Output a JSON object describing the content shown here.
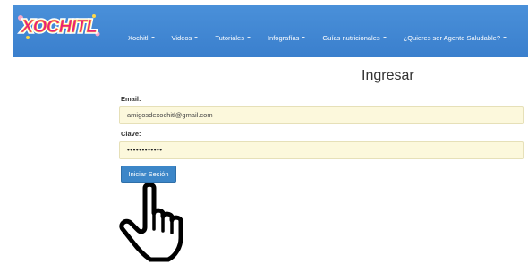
{
  "app": {
    "logo_text": "XOCHITL"
  },
  "navbar": {
    "items": [
      {
        "label": "Xochitl",
        "has_dropdown": true
      },
      {
        "label": "Videos",
        "has_dropdown": true
      },
      {
        "label": "Tutoriales",
        "has_dropdown": true
      },
      {
        "label": "Infografías",
        "has_dropdown": true
      },
      {
        "label": "Guías nutricionales",
        "has_dropdown": true
      },
      {
        "label": "¿Quieres ser Agente Saludable?",
        "has_dropdown": true
      }
    ]
  },
  "login": {
    "title": "Ingresar",
    "email_label": "Email:",
    "email_value": "amigosdexochitl@gmail.com",
    "password_label": "Clave:",
    "password_value": "••••••••••••",
    "submit_label": "Iniciar Sesión"
  },
  "colors": {
    "navbar": "#3f87d6",
    "input_autofill": "#fcf8dc",
    "button": "#3c86c8"
  },
  "icons": {
    "pointer": "hand-pointer-icon"
  }
}
